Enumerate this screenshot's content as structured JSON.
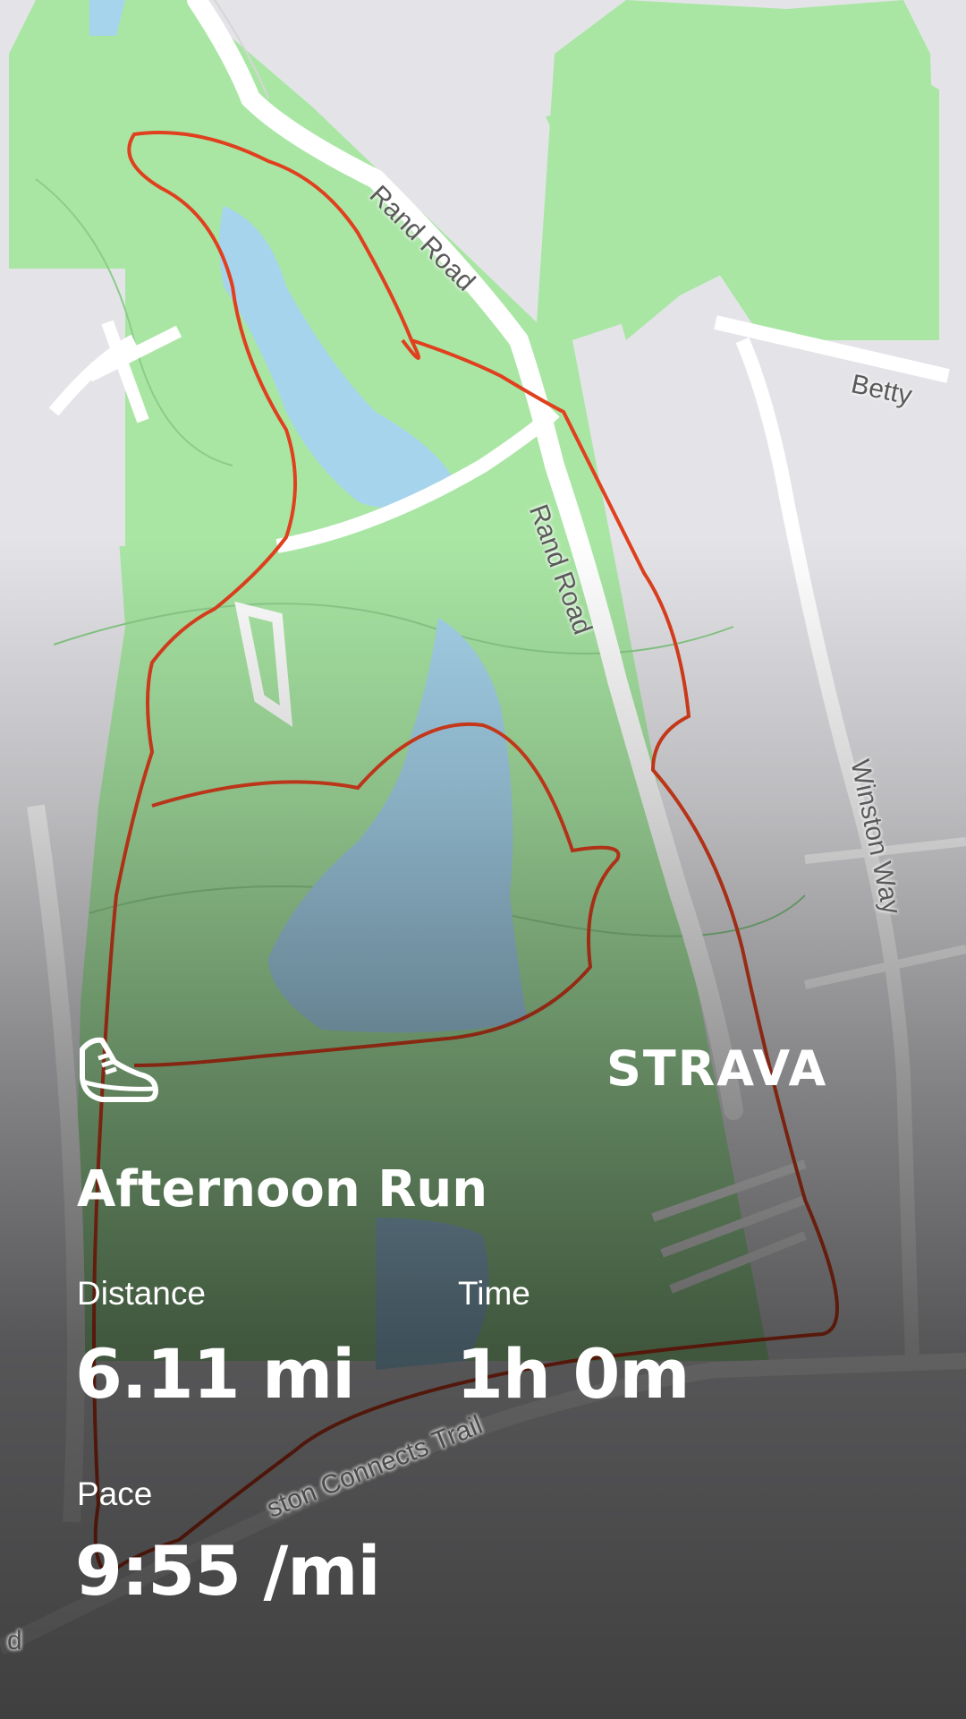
{
  "map": {
    "road_labels": [
      "Rand Road",
      "Rand Road",
      "Betty",
      "Winston Way",
      "ston Connects Trail",
      "d"
    ],
    "route_color": "#e0401e",
    "park_color": "#a6e8a4",
    "water_color": "#a8d7ee"
  },
  "activity": {
    "type_icon": "running-shoe-icon",
    "title": "Afternoon Run",
    "brand": "STRAVA",
    "stats": [
      {
        "label": "Distance",
        "value": "6.11 mi"
      },
      {
        "label": "Time",
        "value": "1h 0m"
      },
      {
        "label": "Pace",
        "value": "9:55 /mi"
      }
    ]
  }
}
